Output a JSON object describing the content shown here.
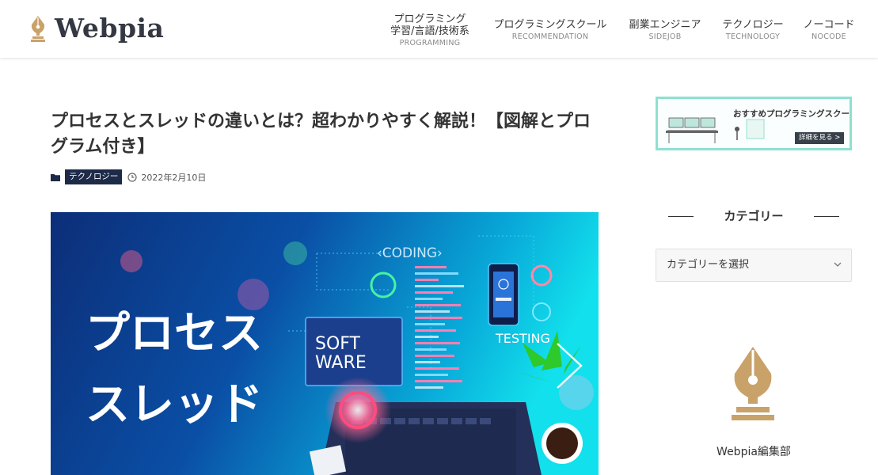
{
  "site": {
    "logo_text": "Webpia"
  },
  "nav": [
    {
      "ja_line1": "プログラミング",
      "ja_line2": "学習/言語/技術系",
      "en": "PROGRAMMING"
    },
    {
      "ja": "プログラミングスクール",
      "en": "RECOMMENDATION"
    },
    {
      "ja": "副業エンジニア",
      "en": "SIDEJOB"
    },
    {
      "ja": "テクノロジー",
      "en": "TECHNOLOGY"
    },
    {
      "ja": "ノーコード",
      "en": "NOCODE"
    }
  ],
  "article": {
    "title": "プロセスとスレッドの違いとは？超わかりやすく解説！【図解とプログラム付き】",
    "category": "テクノロジー",
    "date": "2022年2月10日",
    "hero": {
      "text_line1": "プロセス",
      "text_line2": "スレッド",
      "coding_label": "‹CODING›",
      "testing_label": "TESTING",
      "software_line1": "SOFT",
      "software_line2": "WARE"
    }
  },
  "sidebar": {
    "banner": {
      "title": "おすすめプログラミングスクール",
      "button": "詳細を見る >"
    },
    "category_widget": {
      "title": "カテゴリー",
      "select_value": "カテゴリーを選択"
    },
    "author": {
      "name": "Webpia編集部"
    }
  },
  "colors": {
    "brand_gold": "#c9a26a",
    "badge_navy": "#1d2a48",
    "banner_border": "#8fe0d0"
  }
}
